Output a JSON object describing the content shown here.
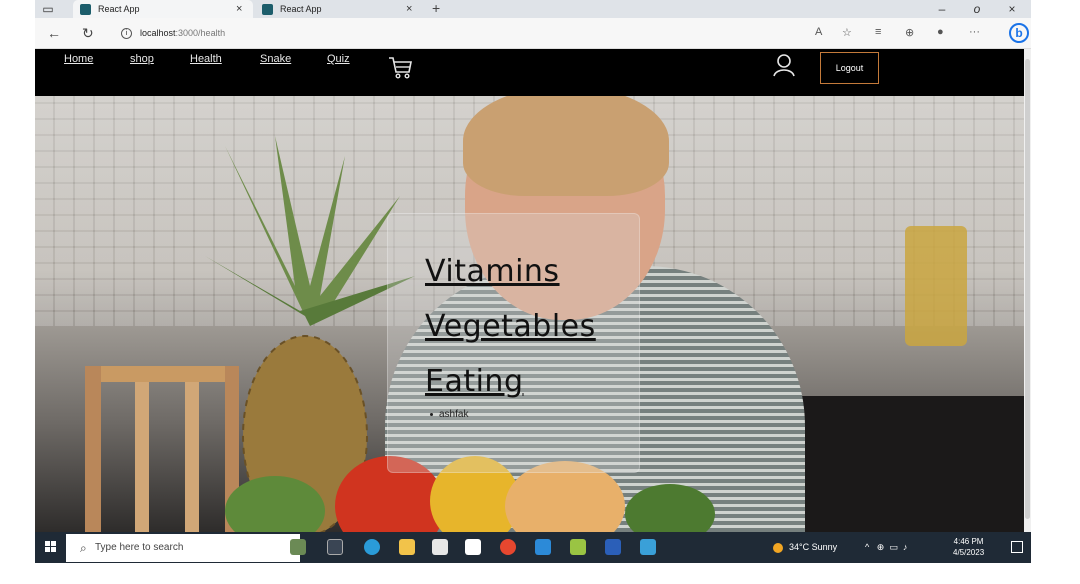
{
  "browser": {
    "tabs": [
      {
        "title": "React App",
        "close": "×",
        "active": true
      },
      {
        "title": "React App",
        "close": "×",
        "active": false
      }
    ],
    "new_tab": "+",
    "window_controls": [
      "–",
      "o",
      "×"
    ],
    "url_host": "localhost",
    "url_path": ":3000/health"
  },
  "navbar": {
    "links": [
      "Home",
      "shop",
      "Health",
      "Snake",
      "Quiz"
    ],
    "logout_label": "Logout"
  },
  "card": {
    "links": [
      "Vitamins",
      "Vegetables",
      "Eating"
    ],
    "list_items": [
      "ashfak"
    ]
  },
  "taskbar": {
    "search_placeholder": "Type here to search",
    "weather": "34°C  Sunny",
    "time": "4:46 PM",
    "date": "4/5/2023"
  },
  "colors": {
    "navbar_bg": "#000000",
    "logout_border": "#c47a3a",
    "taskbar_bg": "#1f2a36"
  }
}
